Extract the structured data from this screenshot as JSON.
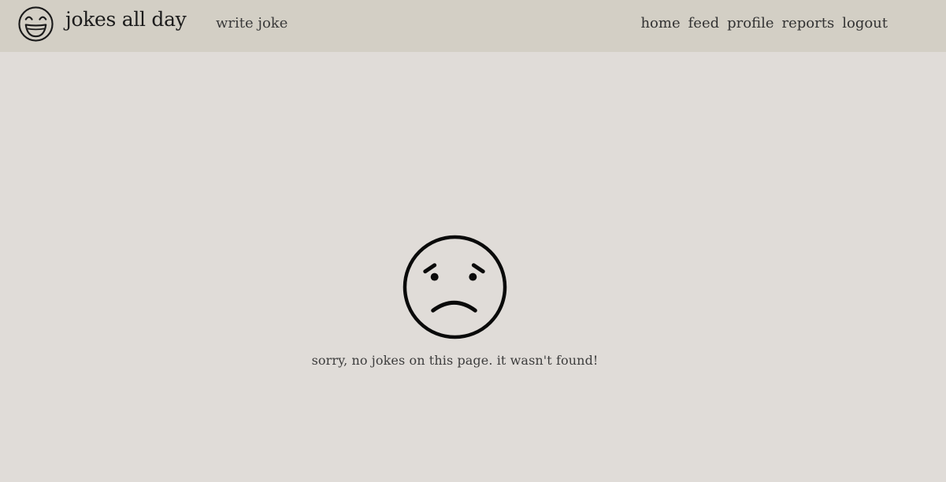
{
  "header": {
    "logo_icon": "laughing-face-icon",
    "brand": "jokes all day",
    "write_joke": "write joke",
    "nav": {
      "home": "home",
      "feed": "feed",
      "profile": "profile",
      "reports": "reports",
      "logout": "logout"
    }
  },
  "main": {
    "icon": "sad-face-icon",
    "message": "sorry, no jokes on this page. it wasn't found!"
  },
  "colors": {
    "navbar_bg": "#d3cfc5",
    "page_bg": "#e0dcd8",
    "text": "#333333"
  }
}
